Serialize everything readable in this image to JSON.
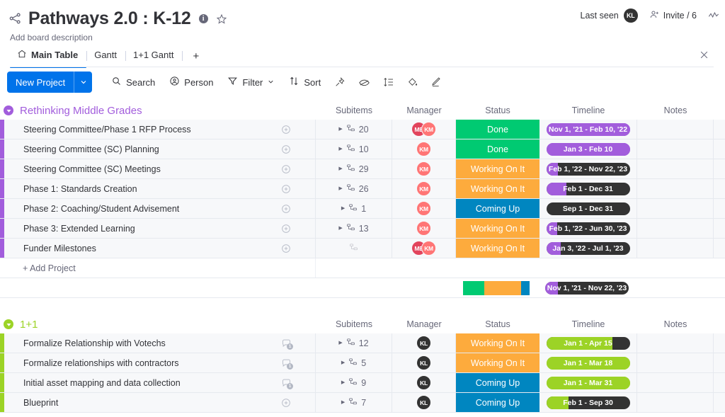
{
  "header": {
    "share_icon": "share-nodes-icon",
    "title": "Pathways 2.0 : K-12",
    "info_glyph": "i",
    "star_icon": "star-icon",
    "description": "Add board description",
    "last_seen_label": "Last seen",
    "last_seen_avatar": "KL",
    "invite_label": "Invite / 6",
    "activity_icon": "activity-icon",
    "integrate_icon": "integrate-icon"
  },
  "tabs": {
    "items": [
      {
        "label": "Main Table",
        "icon": "home-icon",
        "active": true
      },
      {
        "label": "Gantt",
        "icon": "",
        "active": false
      },
      {
        "label": "1+1 Gantt",
        "icon": "",
        "active": false
      }
    ],
    "add_label": "+"
  },
  "toolbar": {
    "new_project_label": "New Project",
    "new_project_caret": "chevron-down-icon",
    "items": [
      {
        "label": "Search",
        "icon": "search-icon"
      },
      {
        "label": "Person",
        "icon": "person-icon"
      },
      {
        "label": "Filter",
        "icon": "filter-icon",
        "caret": true
      },
      {
        "label": "Sort",
        "icon": "sort-icon"
      }
    ],
    "icon_buttons": [
      "pin-icon",
      "eye-off-icon",
      "row-height-icon",
      "paint-bucket-icon",
      "pencil-icon"
    ]
  },
  "columns": [
    "Subitems",
    "Manager",
    "Status",
    "Timeline",
    "Notes"
  ],
  "colors": {
    "accent_blue": "#0073ea",
    "status_done": "#00ca72",
    "status_working": "#fdab3d",
    "status_coming": "#0086c0",
    "group1": "#a25ddc",
    "group2": "#9cd326",
    "timeline_purple": "#a25ddc",
    "timeline_green": "#9cd326",
    "timeline_dark": "#333333",
    "avatar_pink": "#ff7575",
    "avatar_crimson": "#e2445c",
    "avatar_dark": "#333333"
  },
  "groups": [
    {
      "name": "Rethinking Middle Grades",
      "color": "#a25ddc",
      "collapse_icon": "collapse-icon",
      "add_label": "+ Add Project",
      "rows": [
        {
          "name": "Steering Committee/Phase 1 RFP Process",
          "chat_icon": "add-comment-icon",
          "chat_count": "",
          "subitems": "20",
          "managers": [
            {
              "initials": "ME",
              "color": "#e2445c"
            },
            {
              "initials": "KM",
              "color": "#ff7575"
            }
          ],
          "status": "Done",
          "status_color": "#00ca72",
          "timeline": "Nov 1, '21 - Feb 10, '22",
          "timeline_fill_pct": 100,
          "timeline_fill_color": "#a25ddc",
          "timeline_bg": "#a25ddc"
        },
        {
          "name": "Steering Committee (SC) Planning",
          "chat_icon": "add-comment-icon",
          "chat_count": "",
          "subitems": "10",
          "managers": [
            {
              "initials": "KM",
              "color": "#ff7575"
            }
          ],
          "status": "Done",
          "status_color": "#00ca72",
          "timeline": "Jan 3 - Feb 10",
          "timeline_fill_pct": 100,
          "timeline_fill_color": "#a25ddc",
          "timeline_bg": "#a25ddc"
        },
        {
          "name": "Steering Committee (SC) Meetings",
          "chat_icon": "add-comment-icon",
          "chat_count": "",
          "subitems": "29",
          "managers": [
            {
              "initials": "KM",
              "color": "#ff7575"
            }
          ],
          "status": "Working On It",
          "status_color": "#fdab3d",
          "timeline": "Feb 1, '22 - Nov 22, '23",
          "timeline_fill_pct": 14,
          "timeline_fill_color": "#a25ddc",
          "timeline_bg": "#333333"
        },
        {
          "name": "Phase 1: Standards Creation",
          "chat_icon": "add-comment-icon",
          "chat_count": "",
          "subitems": "26",
          "managers": [
            {
              "initials": "KM",
              "color": "#ff7575"
            }
          ],
          "status": "Working On It",
          "status_color": "#fdab3d",
          "timeline": "Feb 1 - Dec 31",
          "timeline_fill_pct": 24,
          "timeline_fill_color": "#a25ddc",
          "timeline_bg": "#333333"
        },
        {
          "name": "Phase 2: Coaching/Student Advisement",
          "chat_icon": "add-comment-icon",
          "chat_count": "",
          "subitems": "1",
          "managers": [
            {
              "initials": "KM",
              "color": "#ff7575"
            }
          ],
          "status": "Coming Up",
          "status_color": "#0086c0",
          "timeline": "Sep 1 - Dec 31",
          "timeline_fill_pct": 0,
          "timeline_fill_color": "#a25ddc",
          "timeline_bg": "#333333"
        },
        {
          "name": "Phase 3: Extended Learning",
          "chat_icon": "add-comment-icon",
          "chat_count": "",
          "subitems": "13",
          "managers": [
            {
              "initials": "KM",
              "color": "#ff7575"
            }
          ],
          "status": "Working On It",
          "status_color": "#fdab3d",
          "timeline": "Feb 1, '22 - Jun 30, '23",
          "timeline_fill_pct": 13,
          "timeline_fill_color": "#a25ddc",
          "timeline_bg": "#333333"
        },
        {
          "name": "Funder Milestones",
          "chat_icon": "add-comment-icon",
          "chat_count": "",
          "subitems": "",
          "managers": [
            {
              "initials": "ME",
              "color": "#e2445c"
            },
            {
              "initials": "KM",
              "color": "#ff7575"
            }
          ],
          "status": "Working On It",
          "status_color": "#fdab3d",
          "timeline": "Jan 3, '22 - Jul 1, '23",
          "timeline_fill_pct": 17,
          "timeline_fill_color": "#a25ddc",
          "timeline_bg": "#333333"
        }
      ],
      "summary": {
        "status_segments": [
          {
            "color": "#00ca72",
            "pct": 32
          },
          {
            "color": "#fdab3d",
            "pct": 55
          },
          {
            "color": "#0086c0",
            "pct": 13
          }
        ],
        "timeline": "Nov 1, '21 - Nov 22, '23",
        "timeline_fill_pct": 15,
        "timeline_fill_color": "#a25ddc",
        "timeline_bg": "#333333"
      }
    },
    {
      "name": "1+1",
      "color": "#9cd326",
      "collapse_icon": "collapse-icon",
      "add_label": "+ Add Project",
      "rows": [
        {
          "name": "Formalize Relationship with Votechs",
          "chat_icon": "comment-icon",
          "chat_count": "1",
          "subitems": "12",
          "managers": [
            {
              "initials": "KL",
              "color": "#333333"
            }
          ],
          "status": "Working On It",
          "status_color": "#fdab3d",
          "timeline": "Jan 1 - Apr 15",
          "timeline_fill_pct": 79,
          "timeline_fill_color": "#9cd326",
          "timeline_bg": "#333333"
        },
        {
          "name": "Formalize relationships with contractors",
          "chat_icon": "comment-icon",
          "chat_count": "1",
          "subitems": "5",
          "managers": [
            {
              "initials": "KL",
              "color": "#333333"
            }
          ],
          "status": "Working On It",
          "status_color": "#fdab3d",
          "timeline": "Jan 1 - Mar 18",
          "timeline_fill_pct": 100,
          "timeline_fill_color": "#9cd326",
          "timeline_bg": "#9cd326"
        },
        {
          "name": "Initial asset mapping and data collection",
          "chat_icon": "comment-icon",
          "chat_count": "1",
          "subitems": "9",
          "managers": [
            {
              "initials": "KL",
              "color": "#333333"
            }
          ],
          "status": "Coming Up",
          "status_color": "#0086c0",
          "timeline": "Jan 1 - Mar 31",
          "timeline_fill_pct": 100,
          "timeline_fill_color": "#9cd326",
          "timeline_bg": "#9cd326"
        },
        {
          "name": "Blueprint",
          "chat_icon": "add-comment-icon",
          "chat_count": "",
          "subitems": "7",
          "managers": [
            {
              "initials": "KL",
              "color": "#333333"
            }
          ],
          "status": "Coming Up",
          "status_color": "#0086c0",
          "timeline": "Feb 1 - Sep 30",
          "timeline_fill_pct": 27,
          "timeline_fill_color": "#9cd326",
          "timeline_bg": "#333333"
        }
      ]
    }
  ]
}
